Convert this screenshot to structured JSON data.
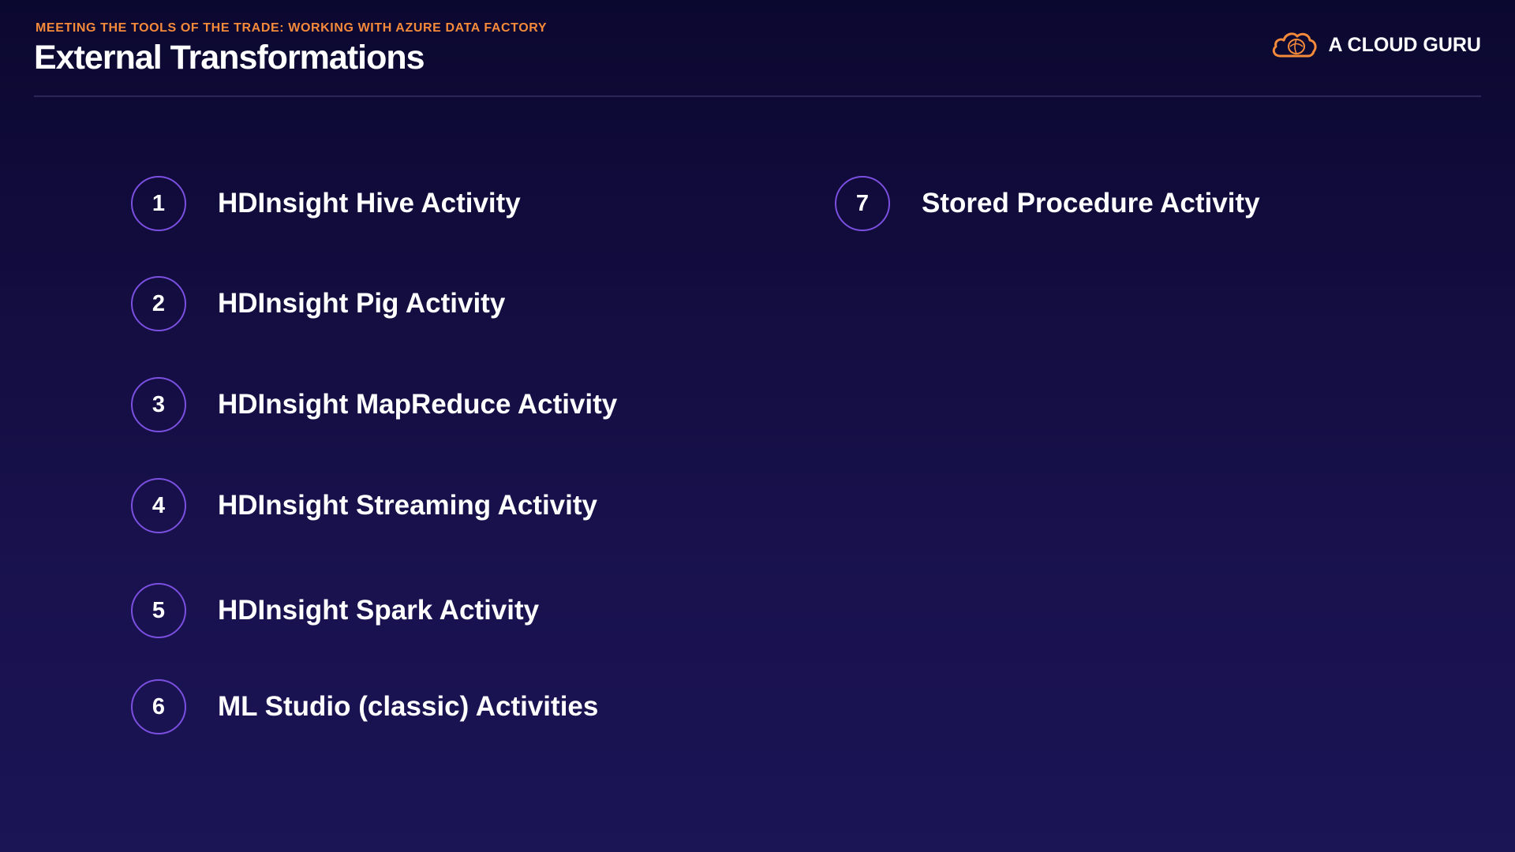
{
  "header": {
    "kicker": "MEETING THE TOOLS OF THE TRADE: WORKING WITH AZURE DATA FACTORY",
    "title": "External Transformations"
  },
  "brand": {
    "name": "A CLOUD GURU",
    "logo_icon": "cloud-logo-icon",
    "accent_color": "#f58a3a"
  },
  "items": [
    {
      "number": "1",
      "label": "HDInsight Hive Activity"
    },
    {
      "number": "2",
      "label": "HDInsight Pig Activity"
    },
    {
      "number": "3",
      "label": "HDInsight MapReduce Activity"
    },
    {
      "number": "4",
      "label": "HDInsight Streaming Activity"
    },
    {
      "number": "5",
      "label": "HDInsight Spark Activity"
    },
    {
      "number": "6",
      "label": "ML Studio (classic) Activities"
    },
    {
      "number": "7",
      "label": "Stored Procedure Activity"
    }
  ],
  "colors": {
    "badge_ring": "#7b4fe0",
    "background": "#160f46"
  }
}
